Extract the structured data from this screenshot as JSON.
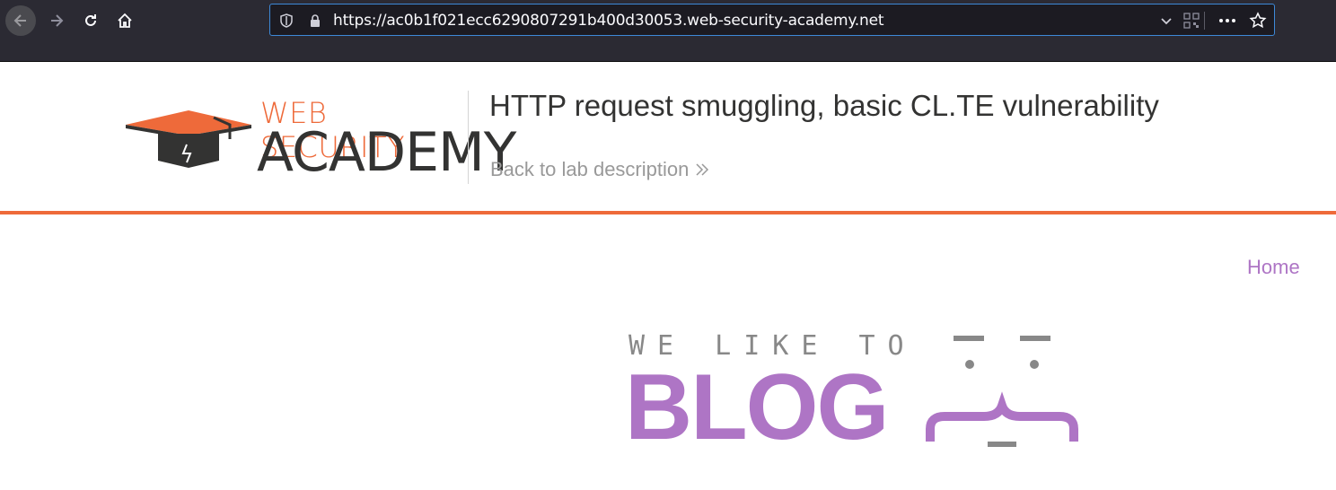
{
  "browser": {
    "url": "https://ac0b1f021ecc6290807291b400d30053.web-security-academy.net",
    "buttons": {
      "back": "back-arrow-icon",
      "forward": "forward-arrow-icon",
      "reload": "reload-icon",
      "home": "home-icon"
    }
  },
  "academy": {
    "logo_line1": "WEB SECURITY",
    "logo_line2": "ACADEMY",
    "lab_title": "HTTP request smuggling, basic CL.TE vulnerability",
    "back_link": "Back to lab description",
    "accent_color": "#ee6a3a"
  },
  "blog": {
    "nav_home": "Home",
    "banner_top": "WE LIKE TO",
    "banner_main": "BLOG",
    "accent_color": "#ae75c5"
  }
}
